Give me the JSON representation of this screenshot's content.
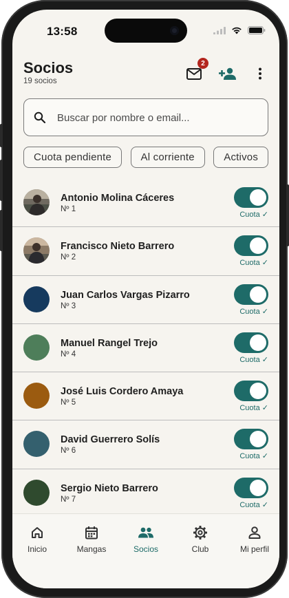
{
  "status_bar": {
    "time": "13:58"
  },
  "header": {
    "title": "Socios",
    "subtitle": "19 socios",
    "mail_badge": "2"
  },
  "search": {
    "placeholder": "Buscar por nombre o email..."
  },
  "filters": [
    "Cuota pendiente",
    "Al corriente",
    "Activos"
  ],
  "members": [
    {
      "name": "Antonio Molina Cáceres",
      "number": "Nº 1",
      "status": "Cuota ✓",
      "active": true,
      "avatar": "photo"
    },
    {
      "name": "Francisco Nieto Barrero",
      "number": "Nº 2",
      "status": "Cuota ✓",
      "active": true,
      "avatar": "photo"
    },
    {
      "name": "Juan Carlos Vargas Pizarro",
      "number": "Nº 3",
      "status": "Cuota ✓",
      "active": true,
      "avatar": "#163a5e"
    },
    {
      "name": "Manuel Rangel Trejo",
      "number": "Nº 4",
      "status": "Cuota ✓",
      "active": true,
      "avatar": "#4e7e5a"
    },
    {
      "name": "José Luis Cordero Amaya",
      "number": "Nº 5",
      "status": "Cuota ✓",
      "active": true,
      "avatar": "#9b5b10"
    },
    {
      "name": "David Guerrero Solís",
      "number": "Nº 6",
      "status": "Cuota ✓",
      "active": true,
      "avatar": "#34606e"
    },
    {
      "name": "Sergio Nieto Barrero",
      "number": "Nº 7",
      "status": "Cuota ✓",
      "active": true,
      "avatar": "#2f4a2e"
    }
  ],
  "nav": {
    "items": [
      {
        "label": "Inicio",
        "icon": "home-icon"
      },
      {
        "label": "Mangas",
        "icon": "calendar-icon"
      },
      {
        "label": "Socios",
        "icon": "people-icon",
        "active": true
      },
      {
        "label": "Club",
        "icon": "gear-icon"
      },
      {
        "label": "Mi perfil",
        "icon": "person-icon"
      }
    ]
  },
  "colors": {
    "accent": "#1e6b68",
    "background": "#f6f4ef",
    "badge": "#b3261e"
  }
}
